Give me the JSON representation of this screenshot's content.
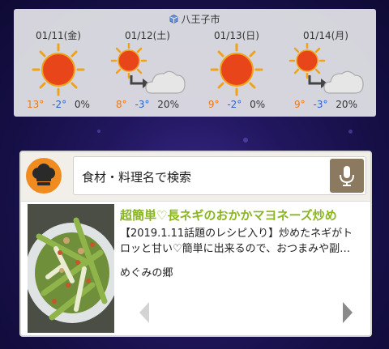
{
  "weather": {
    "location": "八王子市",
    "days": [
      {
        "date": "01/11(金)",
        "icon": "sunny-icon",
        "high": "13°",
        "low": "-2°",
        "precip": "0%"
      },
      {
        "date": "01/12(土)",
        "icon": "sunny-then-cloudy-icon",
        "high": "8°",
        "low": "-3°",
        "precip": "20%"
      },
      {
        "date": "01/13(日)",
        "icon": "sunny-icon",
        "high": "9°",
        "low": "-2°",
        "precip": "0%"
      },
      {
        "date": "01/14(月)",
        "icon": "sunny-then-cloudy-icon",
        "high": "9°",
        "low": "-3°",
        "precip": "20%"
      }
    ],
    "colors": {
      "high": "#e87a1a",
      "low": "#2a63c8",
      "sun": "#e8461a"
    }
  },
  "cookpad": {
    "search_placeholder": "食材・料理名で検索",
    "recipe": {
      "title": "超簡単♡長ネギのおかかマヨネーズ炒め",
      "description": "【2019.1.11話題のレシピ入り】炒めたネギがトロッと甘い♡簡単に出来るので、おつまみや副…",
      "author": "めぐみの郷"
    },
    "colors": {
      "brand": "#f08c1f",
      "title": "#8ab61f",
      "mic": "#8b7a5f"
    }
  }
}
